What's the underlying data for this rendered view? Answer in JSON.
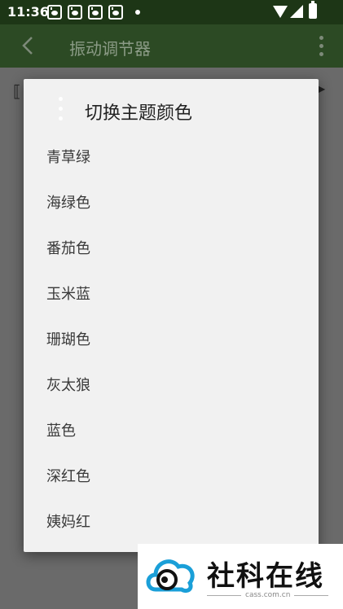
{
  "status_bar": {
    "time": "11:36",
    "notification_icons": [
      "paw-icon",
      "paw-icon",
      "paw-icon",
      "paw-icon"
    ]
  },
  "app_bar": {
    "title": "振动调节器"
  },
  "dialog": {
    "title": "切换主题颜色",
    "items": [
      {
        "label": "青草绿"
      },
      {
        "label": "海绿色"
      },
      {
        "label": "番茄色"
      },
      {
        "label": "玉米蓝"
      },
      {
        "label": "珊瑚色"
      },
      {
        "label": "灰太狼"
      },
      {
        "label": "蓝色"
      },
      {
        "label": "深红色"
      },
      {
        "label": "姨妈红"
      }
    ]
  },
  "watermark": {
    "text": "社科在线",
    "url": "cass.com.cn"
  },
  "colors": {
    "status_bar": "#1d3616",
    "app_bar": "#2c4a24",
    "dialog_bg": "#f1f1f1",
    "scrim": "#5b5b5b"
  }
}
